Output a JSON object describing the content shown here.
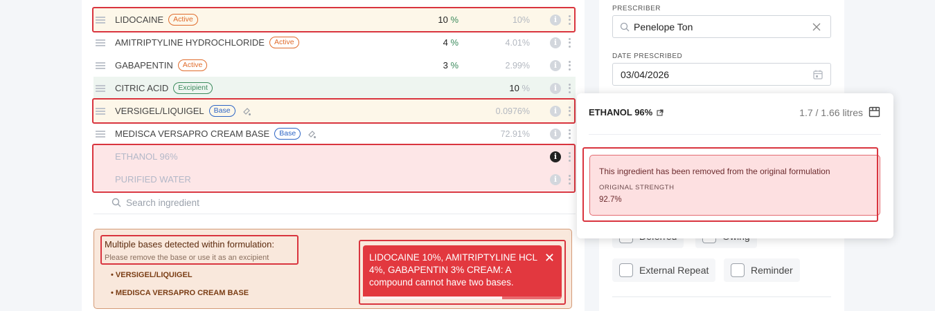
{
  "ingredients": [
    {
      "name": "LIDOCAINE",
      "tag": "Active",
      "strength": "10",
      "unit": "%",
      "percentage": "10%"
    },
    {
      "name": "AMITRIPTYLINE HYDROCHLORIDE",
      "tag": "Active",
      "strength": "4",
      "unit": "%",
      "percentage": "4.01%"
    },
    {
      "name": "GABAPENTIN",
      "tag": "Active",
      "strength": "3",
      "unit": "%",
      "percentage": "2.99%"
    },
    {
      "name": "CITRIC ACID",
      "tag": "Excipient",
      "strength": "10",
      "unit": "%",
      "percentage": ""
    },
    {
      "name": "VERSIGEL/LIQUIGEL",
      "tag": "Base",
      "strength": "",
      "unit": "",
      "percentage": "0.0976%"
    },
    {
      "name": "MEDISCA VERSAPRO CREAM BASE",
      "tag": "Base",
      "strength": "",
      "unit": "",
      "percentage": "72.91%"
    },
    {
      "name": "ETHANOL 96%"
    },
    {
      "name": "PURIFIED WATER"
    }
  ],
  "search": {
    "placeholder": "Search ingredient"
  },
  "warning": {
    "title": "Multiple bases detected within formulation:",
    "subtitle": "Please remove the base or use it as an excipient",
    "items": [
      "VERSIGEL/LIQUIGEL",
      "MEDISCA VERSAPRO CREAM BASE"
    ]
  },
  "toast": {
    "message": "LIDOCAINE 10%, AMITRIPTYLINE HCL 4%, GABAPENTIN 3% CREAM: A compound cannot have two bases.",
    "close": "✕"
  },
  "prescriber": {
    "label": "PRESCRIBER",
    "value": "Penelope Ton"
  },
  "date_prescribed": {
    "label": "DATE PRESCRIBED",
    "value": "03/04/2026"
  },
  "checkboxes": {
    "row1": [
      "Deferred",
      "Owing"
    ],
    "row2": [
      "External Repeat",
      "Reminder"
    ]
  },
  "popover": {
    "title": "ETHANOL 96%",
    "quantity": "1.7 / 1.66 litres",
    "message": "This ingredient has been removed from the original formulation",
    "strength_label": "ORIGINAL STRENGTH",
    "strength_value": "92.7%"
  },
  "colors": {
    "alert_red": "#e2383f",
    "active_orange": "#e06b2b",
    "excipient_green": "#3b8a5c",
    "base_blue": "#2c64c5",
    "highlight_border": "#d9343e"
  },
  "icons": {
    "drag": "drag-handle-icon",
    "info": "info-icon",
    "more": "kebab-icon",
    "search": "search-icon",
    "clear": "close-icon",
    "calendar": "calendar-icon",
    "external": "external-link-icon",
    "store": "store-icon",
    "dropper": "dropper-icon"
  }
}
